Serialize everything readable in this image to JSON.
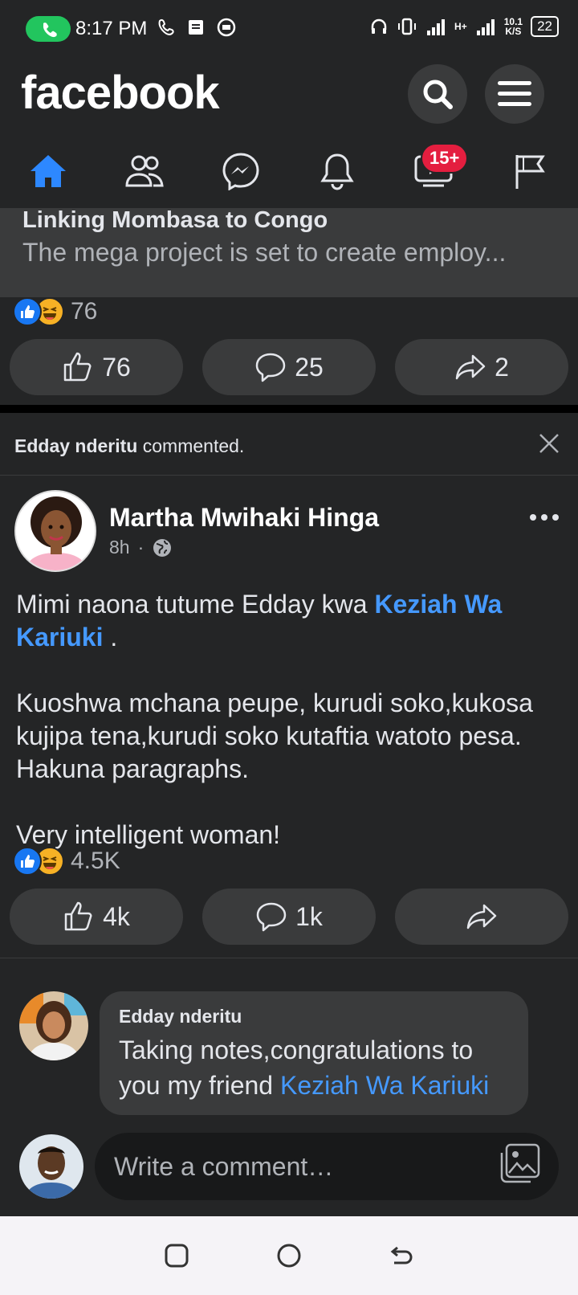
{
  "status_bar": {
    "time": "8:17 PM",
    "net_speed_value": "10.1",
    "net_speed_unit": "K/S",
    "signal_label": "H+",
    "battery": "22"
  },
  "header": {
    "logo": "facebook"
  },
  "nav": {
    "video_badge": "15+"
  },
  "link_preview": {
    "title": "Linking Mombasa to Congo",
    "description": "The mega project is set to create employ..."
  },
  "post1": {
    "reaction_count": "76",
    "like_count": "76",
    "comment_count": "25",
    "share_count": "2"
  },
  "notice": {
    "actor": "Edday nderitu",
    "action": " commented."
  },
  "post2": {
    "author": "Martha Mwihaki Hinga",
    "time": "8h",
    "separator": "·",
    "line1_prefix": "Mimi naona tutume Edday kwa ",
    "line1_mention": "Keziah Wa Kariuki",
    "line1_suffix": " .",
    "paragraph2": "Kuoshwa mchana peupe, kurudi soko,kukosa kujipa tena,kurudi soko kutaftia watoto pesa. Hakuna paragraphs.",
    "paragraph3": "Very intelligent woman!",
    "reaction_count": "4.5K",
    "like_count": "4k",
    "comment_count": "1k"
  },
  "comment": {
    "author": "Edday nderitu",
    "text_prefix": "Taking notes,congratulations to you my friend ",
    "text_tag": "Keziah Wa Kariuki"
  },
  "composer": {
    "placeholder": "Write a comment…"
  },
  "colors": {
    "accent": "#1877f2",
    "mention": "#4599ff",
    "badge": "#e41e3f",
    "call_pill": "#22c55e"
  }
}
